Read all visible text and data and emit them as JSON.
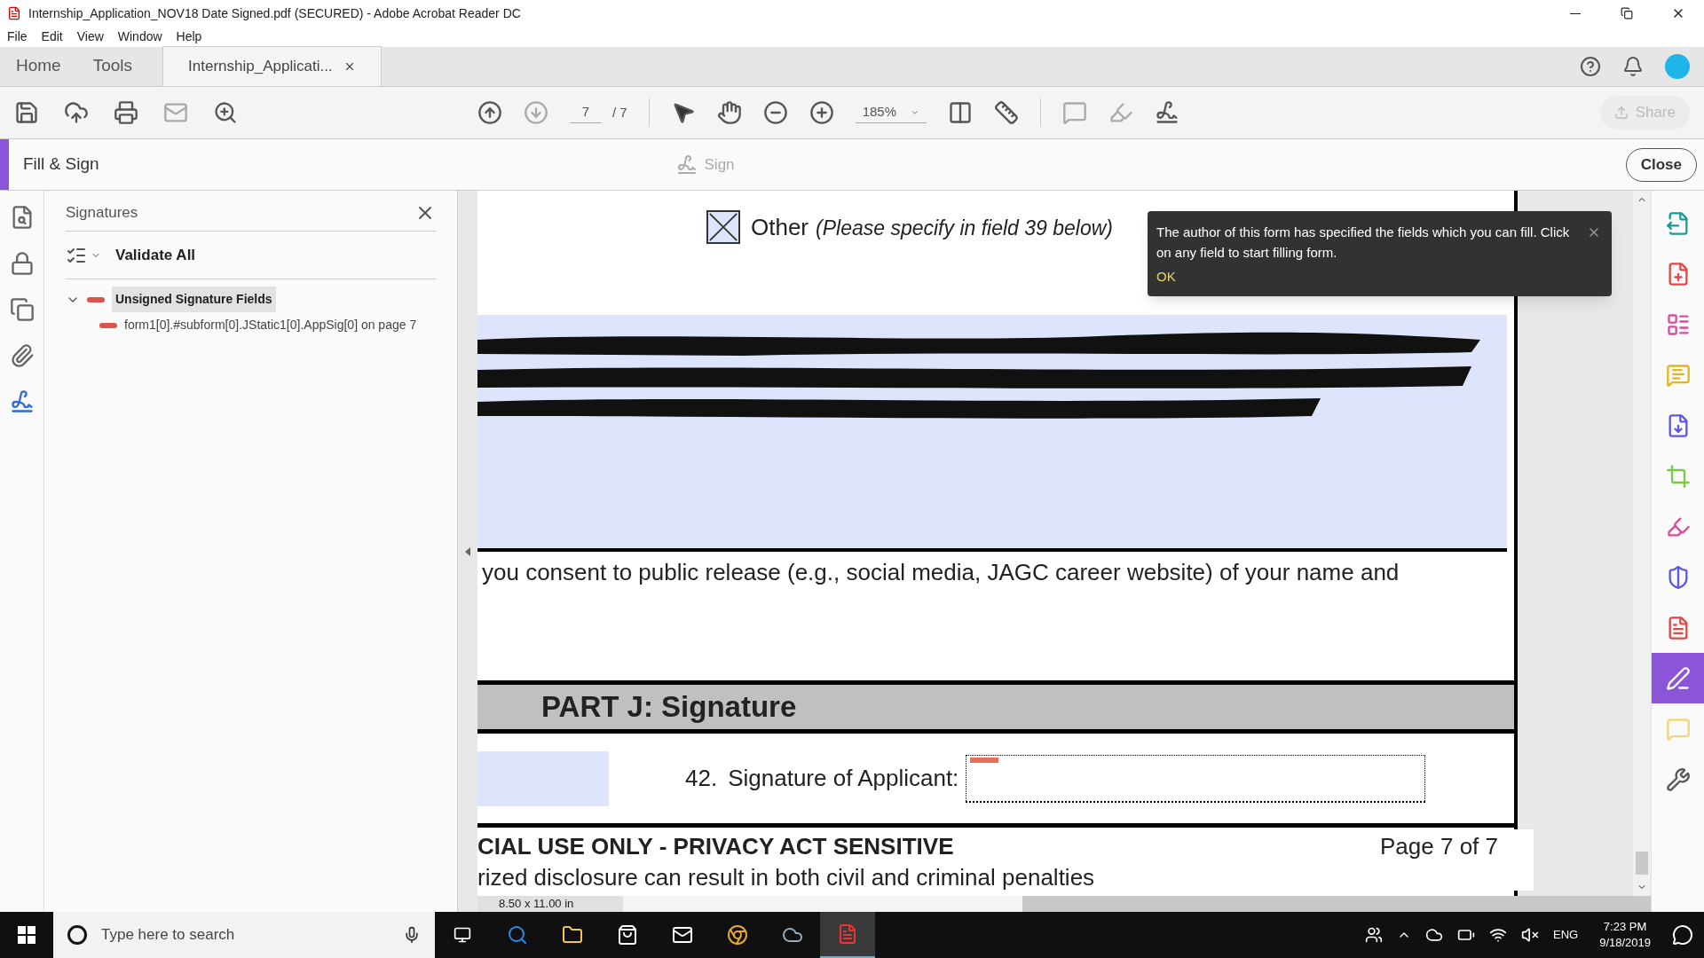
{
  "window": {
    "title": "Internship_Application_NOV18 Date Signed.pdf (SECURED) - Adobe Acrobat Reader DC"
  },
  "menu": [
    "File",
    "Edit",
    "View",
    "Window",
    "Help"
  ],
  "tabs": [
    {
      "label": "Home",
      "selected": false,
      "kind": "nav"
    },
    {
      "label": "Tools",
      "selected": false,
      "kind": "nav"
    },
    {
      "label": "Internship_Applicati...",
      "selected": true,
      "kind": "document"
    }
  ],
  "toolbar": {
    "page": "7",
    "page_total": "/ 7",
    "zoom": "185%",
    "share": "Share"
  },
  "fill_sign": {
    "title": "Fill & Sign",
    "sign": "Sign",
    "close": "Close"
  },
  "left_rail": [
    {
      "selected": false
    },
    {
      "selected": false
    },
    {
      "selected": false
    },
    {
      "selected": false
    },
    {
      "selected": true
    }
  ],
  "signatures_panel": {
    "title": "Signatures",
    "validate": "Validate All",
    "tree": [
      {
        "label": "Unsigned Signature Fields",
        "expanded": true,
        "selected": true,
        "children": [
          {
            "label": "form1[0].#subform[0].JStatic1[0].AppSig[0] on page 7",
            "selected": false
          }
        ]
      }
    ]
  },
  "document": {
    "checkbox": {
      "checked": true,
      "label": "Other",
      "note": "(Please specify in field 39 below)"
    },
    "consent": "you consent to public release (e.g., social media, JAGC career website) of your name and",
    "part_title": "PART J: Signature",
    "field_number": "42.",
    "field_label": "Signature of Applicant:",
    "footer_title": "CIAL USE ONLY - PRIVACY ACT SENSITIVE",
    "footer_note": "rized disclosure can result in both civil and criminal penalties",
    "page_label": "Page 7 of 7",
    "page_size": "8.50 x 11.00 in"
  },
  "tooltip": {
    "text": "The author of this form has specified the fields which you can fill. Click on any field to start filling form.",
    "ok": "OK"
  },
  "right_rail": [
    {
      "color": "#1a9a9a",
      "selected": false
    },
    {
      "color": "#e04848",
      "selected": false
    },
    {
      "color": "#d94c9c",
      "selected": false
    },
    {
      "color": "#e3b520",
      "selected": false
    },
    {
      "color": "#5a5ae0",
      "selected": false
    },
    {
      "color": "#7ac943",
      "selected": false
    },
    {
      "color": "#d94c9c",
      "selected": false
    },
    {
      "color": "#5a5ae0",
      "selected": false
    },
    {
      "color": "#e04848",
      "selected": false
    },
    {
      "color": "#ffffff",
      "selected": true
    },
    {
      "color": "#f0d77a",
      "selected": false
    },
    {
      "color": "#555555",
      "selected": false
    }
  ],
  "taskbar": {
    "search_placeholder": "Type here to search",
    "language": "ENG",
    "time": "7:23 PM",
    "date": "9/18/2019"
  }
}
